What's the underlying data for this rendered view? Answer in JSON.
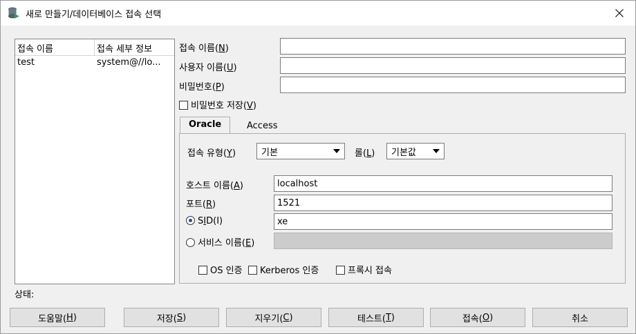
{
  "window": {
    "title": "새로 만들기/데이터베이스 접속 선택",
    "close_icon": "close-icon"
  },
  "list": {
    "headers": [
      "접속 이름",
      "접속 세부 정보"
    ],
    "rows": [
      {
        "name": "test",
        "details": "system@//lo..."
      }
    ]
  },
  "form": {
    "conn_name_label": "접속 이름(",
    "conn_name_key": "N",
    "user_label": "사용자 이름(",
    "user_key": "U",
    "password_label": "비밀번호(",
    "password_key": "P",
    "save_password_label": "비밀번호 저장(",
    "save_password_key": "V",
    "conn_name_value": "",
    "user_value": "",
    "password_value": ""
  },
  "tabs": [
    {
      "label": "Oracle"
    },
    {
      "label": "Access"
    }
  ],
  "oracle": {
    "conn_type_label": "접속 유형(",
    "conn_type_key": "Y",
    "conn_type_value": "기본",
    "role_label": "롤(",
    "role_key": "L",
    "role_value": "기본값",
    "host_label": "호스트 이름(",
    "host_key": "A",
    "host_value": "localhost",
    "port_label": "포트(",
    "port_key": "R",
    "port_value": "1521",
    "sid_label_pre": "S",
    "sid_key": "I",
    "sid_label_post": "D(I)",
    "sid_value": "xe",
    "service_label": "서비스 이름(",
    "service_key": "E",
    "os_auth": "OS 인증",
    "kerberos": "Kerberos 인증",
    "proxy": "프록시 접속"
  },
  "status_label": "상태:",
  "buttons": {
    "help": "도움말(",
    "help_key": "H",
    "save": "저장(",
    "save_key": "S",
    "clear": "지우기(",
    "clear_key": "C",
    "test": "테스트(",
    "test_key": "T",
    "connect": "접속(",
    "connect_key": "O",
    "cancel": "취소"
  }
}
